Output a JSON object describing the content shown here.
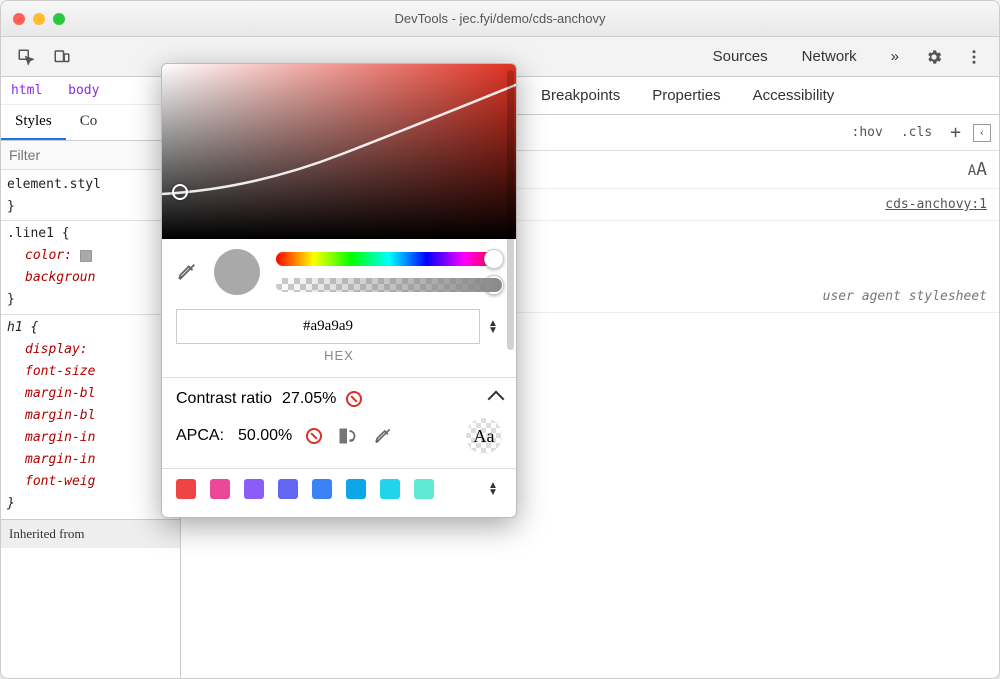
{
  "window": {
    "title": "DevTools - jec.fyi/demo/cds-anchovy"
  },
  "toolbar": {
    "visible_tabs": [
      "Sources",
      "Network"
    ],
    "overflow": "»"
  },
  "breadcrumbs": [
    "html",
    "body"
  ],
  "styles_tabs": {
    "active": "Styles",
    "partial": "Co"
  },
  "filter": {
    "placeholder": "Filter"
  },
  "right_tabs": [
    "Breakpoints",
    "Properties",
    "Accessibility"
  ],
  "filters_bar": {
    "hov": ":hov",
    "cls": ".cls",
    "plus": "+"
  },
  "link_text": "cds-anchovy:1",
  "ua_text": "user agent stylesheet",
  "font_size_glyph_small": "A",
  "font_size_glyph_big": "A",
  "rules": {
    "r0": {
      "sel": "element.styl"
    },
    "r1": {
      "sel": ".line1 {",
      "p1": "color:",
      "p2": "backgroun"
    },
    "r2": {
      "sel": "h1 {",
      "props": [
        "display:",
        "font-size",
        "margin-bl",
        "margin-bl",
        "margin-in",
        "margin-in",
        "font-weig"
      ]
    }
  },
  "inherited": "Inherited from",
  "picker": {
    "hex_value": "#a9a9a9",
    "format": "HEX",
    "contrast_label": "Contrast ratio",
    "contrast_value": "27.05%",
    "apca_label": "APCA:",
    "apca_value": "50.00%",
    "aa_glyph": "Aa",
    "palette": [
      "#ef4444",
      "#ec4899",
      "#8b5cf6",
      "#6366f1",
      "#3b82f6",
      "#0ea5e9",
      "#22d3ee",
      "#5eead4"
    ]
  }
}
